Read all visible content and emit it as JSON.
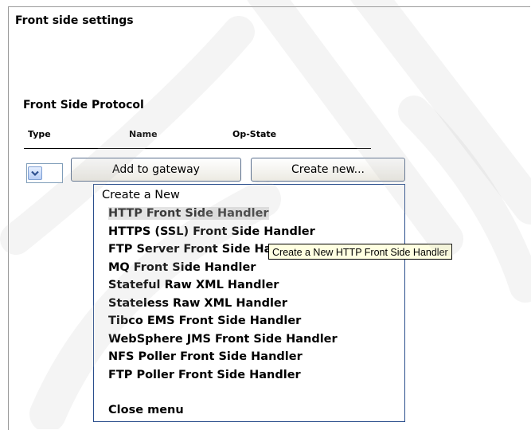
{
  "page": {
    "title": "Front side settings",
    "section_title": "Front Side Protocol"
  },
  "table": {
    "columns": [
      "Type",
      "Name",
      "Op-State"
    ]
  },
  "controls": {
    "type_dropdown_icon": "chevron-down-icon",
    "add_button": "Add to gateway",
    "create_button": "Create new..."
  },
  "menu": {
    "header": "Create a New",
    "items": [
      "HTTP Front Side Handler",
      "HTTPS (SSL) Front Side Handler",
      "FTP Server Front Side Handler",
      "MQ Front Side Handler",
      "Stateful Raw XML Handler",
      "Stateless Raw XML Handler",
      "Tibco EMS Front Side Handler",
      "WebSphere JMS Front Side Handler",
      "NFS Poller Front Side Handler",
      "FTP Poller Front Side Handler"
    ],
    "close": "Close menu",
    "highlighted_index": 0
  },
  "tooltip": {
    "text": "Create a New HTTP Front Side Handler"
  },
  "colors": {
    "menu_border": "#2a4e8c",
    "tooltip_bg": "#ffffe1",
    "highlight_bg": "#e3e3e3"
  }
}
